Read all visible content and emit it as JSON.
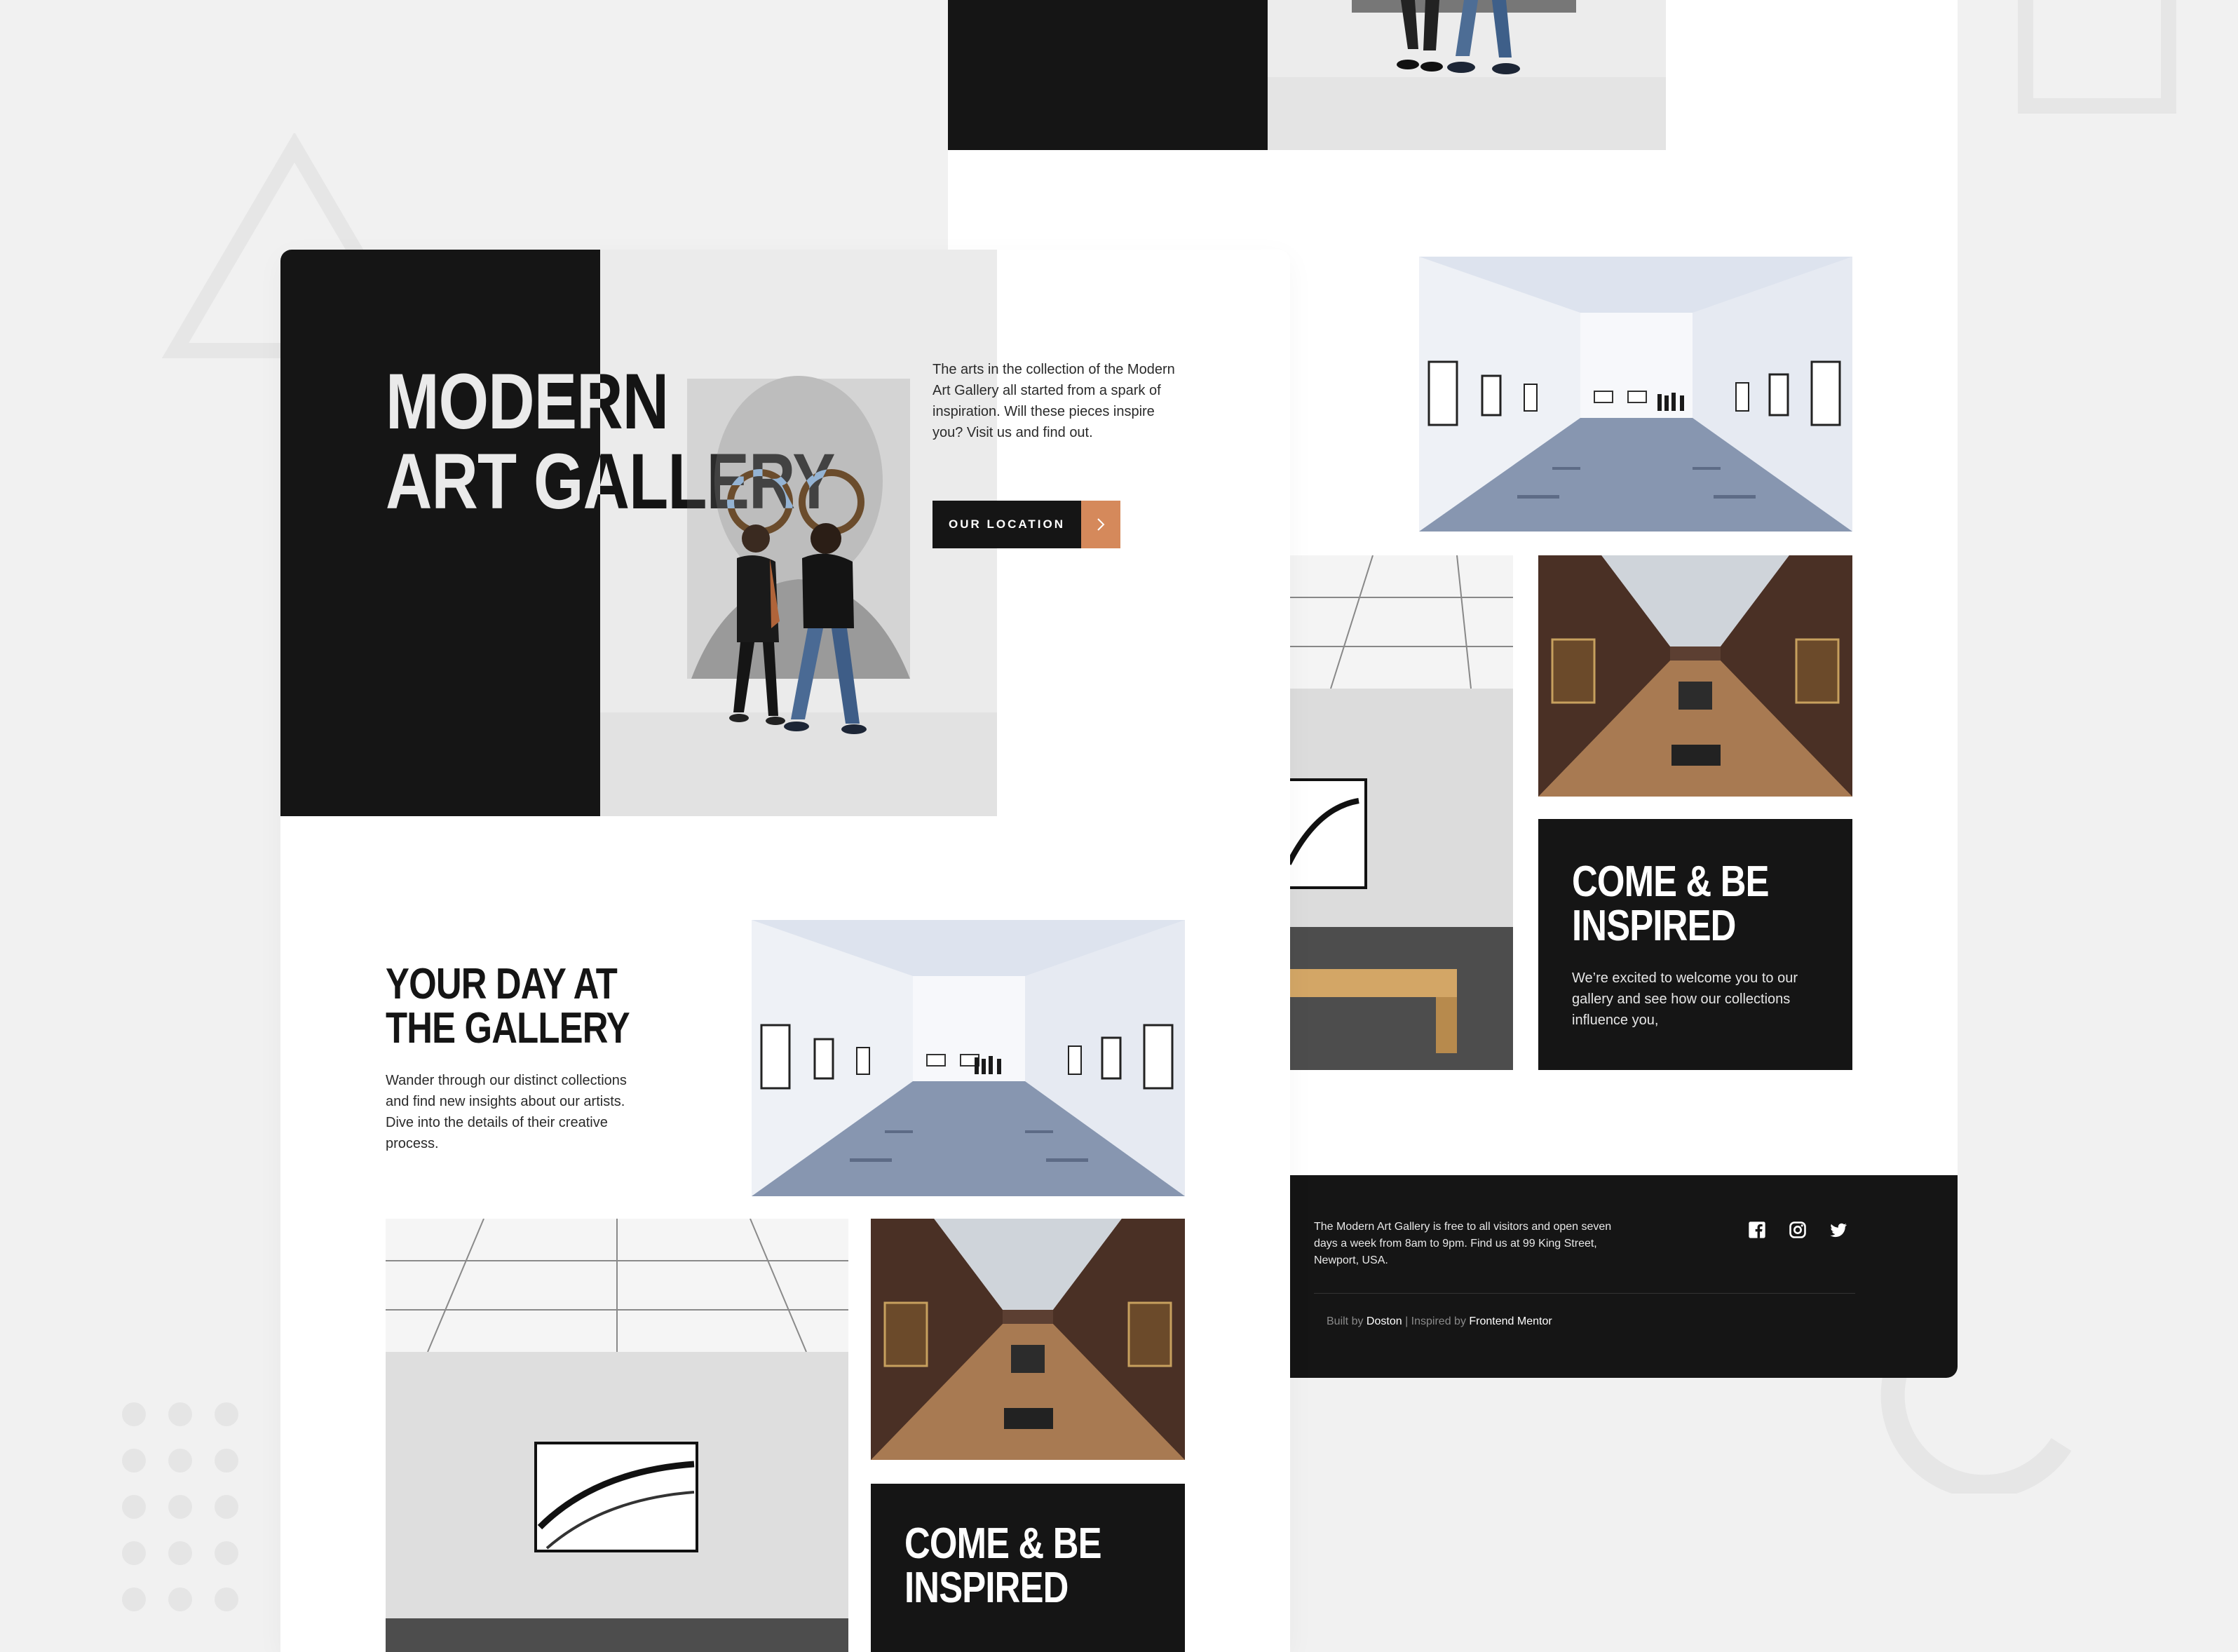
{
  "colors": {
    "background": "#f1f1f1",
    "dark": "#151515",
    "accent": "#d5895b",
    "white": "#ffffff"
  },
  "hero": {
    "title_line1": "MODERN",
    "title_line2": "ART GALLERY",
    "description": "The arts in the collection of the Modern Art Gallery all started from a spark of inspiration. Will these pieces inspire you? Visit us and find out.",
    "location_button": "OUR LOCATION",
    "arrow_icon": "chevron-right-icon"
  },
  "gallery_day": {
    "title_line1": "YOUR DAY AT",
    "title_line2": "THE GALLERY",
    "description": "Wander through our distinct collections and find new insights about our artists. Dive into the details of their creative process."
  },
  "inspired": {
    "title_line1": "COME & BE",
    "title_line2": "INSPIRED",
    "description": "We’re excited to welcome you to our gallery and see how our collections influence you,"
  },
  "footer": {
    "info": "The Modern Art Gallery is free to all visitors and open seven days a week from 8am to 9pm. Find us at 99 King Street, Newport, USA.",
    "social_icons": [
      "facebook-icon",
      "instagram-icon",
      "twitter-icon"
    ],
    "built_by_prefix": "Built by ",
    "author": "Doston",
    "separator": " | Inspired by ",
    "inspired_by": "Frontend Mentor"
  }
}
